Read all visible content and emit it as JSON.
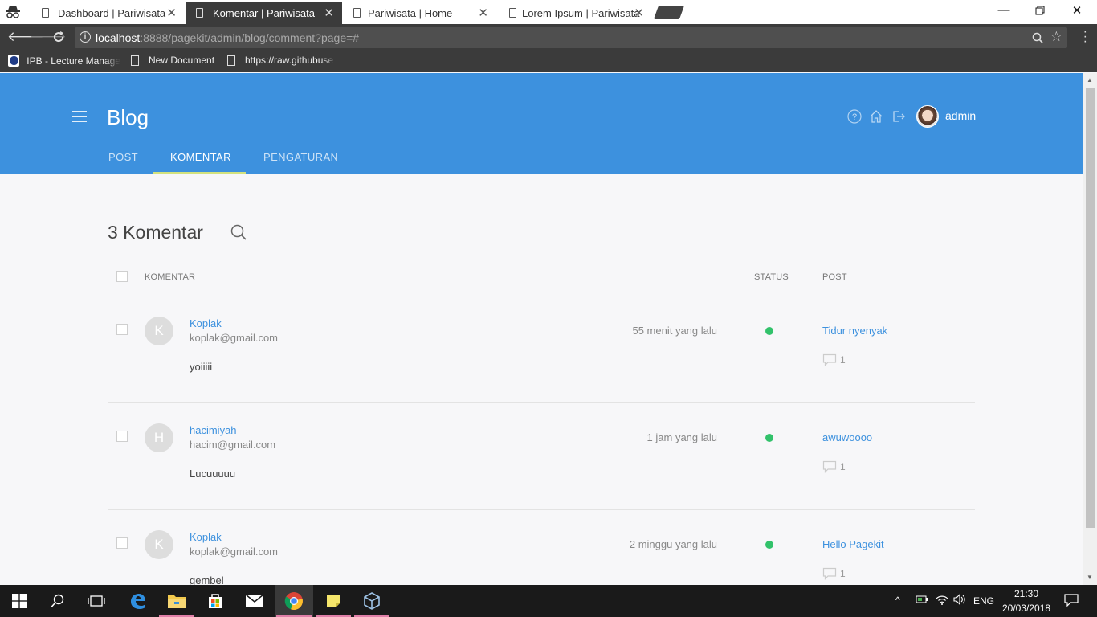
{
  "browser": {
    "tabs": [
      {
        "title": "Dashboard | Pariwisata",
        "active": false
      },
      {
        "title": "Komentar | Pariwisata",
        "active": true
      },
      {
        "title": "Pariwisata | Home",
        "active": false
      },
      {
        "title": "Lorem Ipsum | Pariwisata",
        "active": false
      }
    ],
    "url_host": "localhost",
    "url_rest": ":8888/pagekit/admin/blog/comment?page=#",
    "bookmarks": [
      {
        "label": "IPB - Lecture Manage",
        "icon": "ipb-logo-icon"
      },
      {
        "label": "New Document",
        "icon": "document-icon"
      },
      {
        "label": "https://raw.githubuse",
        "icon": "document-icon"
      }
    ]
  },
  "header": {
    "title": "Blog",
    "tabs": [
      "POST",
      "KOMENTAR",
      "PENGATURAN"
    ],
    "active_tab": "KOMENTAR",
    "user": "admin"
  },
  "main": {
    "count_title": "3 Komentar",
    "columns": {
      "comment": "KOMENTAR",
      "status": "STATUS",
      "post": "POST"
    },
    "rows": [
      {
        "initial": "K",
        "author": "Koplak",
        "email": "koplak@gmail.com",
        "content": "yoiiiii",
        "time": "55 menit yang lalu",
        "status": "approved",
        "post": "Tidur nyenyak",
        "comment_count": "1"
      },
      {
        "initial": "H",
        "author": "hacimiyah",
        "email": "hacim@gmail.com",
        "content": "Lucuuuuu",
        "time": "1 jam yang lalu",
        "status": "approved",
        "post": "awuwoooo",
        "comment_count": "1"
      },
      {
        "initial": "K",
        "author": "Koplak",
        "email": "koplak@gmail.com",
        "content": "gembel",
        "time": "2 minggu yang lalu",
        "status": "approved",
        "post": "Hello Pagekit",
        "comment_count": "1"
      }
    ]
  },
  "colors": {
    "header_blue": "#3d91de",
    "status_green": "#32c26b",
    "tab_underline": "#d3e27e"
  },
  "taskbar": {
    "language": "ENG",
    "time": "21:30",
    "date": "20/03/2018"
  }
}
